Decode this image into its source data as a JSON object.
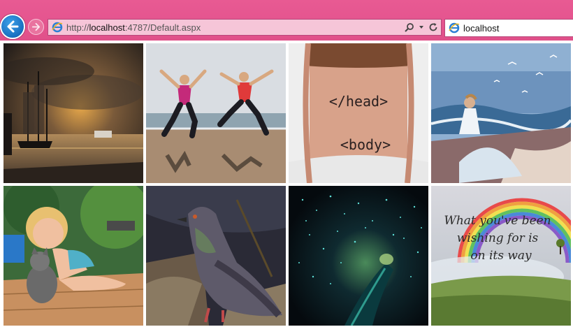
{
  "browser": {
    "url_prefix": "http://",
    "url_host": "localhost",
    "url_rest": ":4787/Default.aspx",
    "tab_title": "localhost",
    "accent": "#e4548e"
  },
  "gallery": {
    "tiles": [
      {
        "name": "tall-ship-sunset"
      },
      {
        "name": "couple-jumping-beach"
      },
      {
        "name": "neck-tattoo-head-body",
        "tattoo_line1": "</head>",
        "tattoo_line2": "<body>"
      },
      {
        "name": "woman-painting-sea"
      },
      {
        "name": "girl-with-kitten"
      },
      {
        "name": "pigeon"
      },
      {
        "name": "glowworm-cave"
      },
      {
        "name": "rainbow-quote",
        "quote_line1": "What you've been",
        "quote_line2": "wishing for is",
        "quote_line3": "on its way"
      }
    ]
  }
}
